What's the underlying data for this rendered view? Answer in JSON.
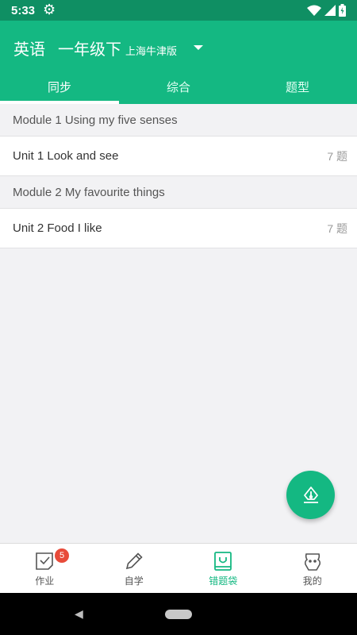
{
  "status_bar": {
    "time": "5:33",
    "icons": [
      "gear-icon",
      "wifi-icon",
      "signal-icon",
      "battery-icon"
    ]
  },
  "header": {
    "subject": "英语",
    "grade": "一年级下",
    "edition": "上海牛津版"
  },
  "tabs": [
    {
      "label": "同步",
      "active": true
    },
    {
      "label": "综合",
      "active": false
    },
    {
      "label": "题型",
      "active": false
    }
  ],
  "modules": [
    {
      "title": "Module 1 Using my five senses",
      "units": [
        {
          "title": "Unit 1 Look and see",
          "count": "7 题"
        }
      ]
    },
    {
      "title": "Module 2 My favourite things",
      "units": [
        {
          "title": "Unit 2 Food I like",
          "count": "7 题"
        }
      ]
    }
  ],
  "bottom_nav": [
    {
      "label": "作业",
      "icon": "homework-icon",
      "badge": "5"
    },
    {
      "label": "自学",
      "icon": "pencil-icon"
    },
    {
      "label": "错题袋",
      "icon": "bag-icon",
      "active": true
    },
    {
      "label": "我的",
      "icon": "profile-icon"
    }
  ],
  "colors": {
    "primary": "#14b882",
    "status_bar": "#0f8f63",
    "badge": "#e84b3a"
  }
}
